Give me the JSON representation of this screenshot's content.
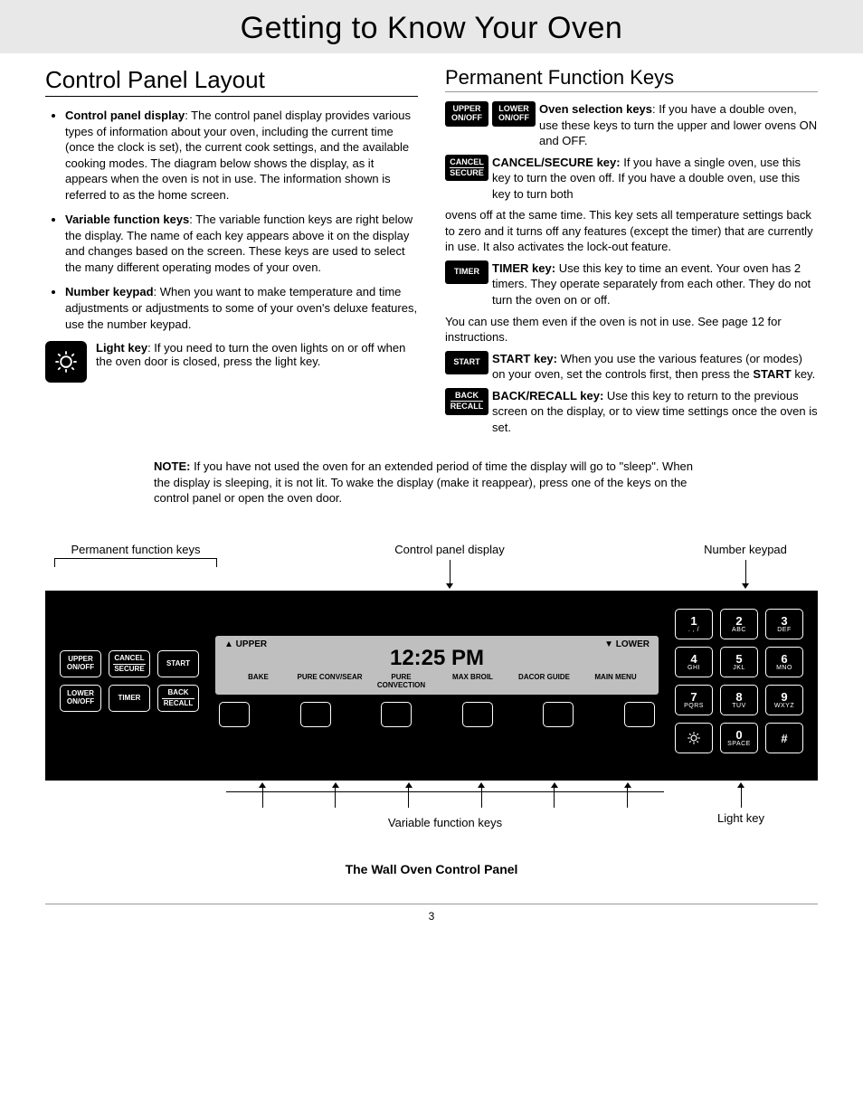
{
  "title": "Getting to Know Your Oven",
  "left": {
    "heading": "Control Panel Layout",
    "items": [
      {
        "lead": "Control panel display",
        "body": ": The control panel display provides various types of information about your oven, including the current time (once the clock is set), the current cook settings, and the available cooking modes. The diagram below shows the display, as it appears when the oven is not in use. The information shown is referred to as the home screen."
      },
      {
        "lead": "Variable function keys",
        "body": ": The variable function keys are right below the display. The name of each key appears above it on the display and changes based on the screen. These keys are used to select the many different operating modes of your oven."
      },
      {
        "lead": "Number keypad",
        "body": ": When you want to make temperature and time adjustments or adjustments to some of your oven's deluxe features, use the number keypad."
      }
    ],
    "light": {
      "lead": "Light key",
      "body": ": If you need to turn the oven lights on or off when the oven door is closed, press the light key."
    }
  },
  "right": {
    "heading": "Permanent Function Keys",
    "oven_sel": {
      "k1": {
        "l1": "UPPER",
        "l2": "ON/OFF"
      },
      "k2": {
        "l1": "LOWER",
        "l2": "ON/OFF"
      },
      "lead": "Oven selection keys",
      "body": ": If you have a double oven, use these keys to turn the upper and lower ovens ON and OFF."
    },
    "cancel": {
      "k": {
        "l1": "CANCEL",
        "l2": "SECURE"
      },
      "lead": "CANCEL/SECURE key:",
      "body": " If you have a single oven, use this key to turn the oven off. If you have a double oven, use this key to turn both",
      "cont": "ovens off at the same time. This key sets all temperature settings back to zero and it turns off any features (except the timer) that are currently in use. It also activates the lock-out feature."
    },
    "timer": {
      "k": {
        "l1": "TIMER"
      },
      "lead": "TIMER key:",
      "body": " Use this key to time an event. Your oven has 2 timers. They operate separately from each other. They do not turn the oven on or off.",
      "cont": "You can use them even if the oven is not in use. See page 12 for instructions."
    },
    "start": {
      "k": {
        "l1": "START"
      },
      "lead": "START key:",
      "body": " When you use the various features (or modes) on your oven, set the controls first, then press the ",
      "body2": "START",
      "body3": " key."
    },
    "back": {
      "k": {
        "l1": "BACK",
        "l2": "RECALL"
      },
      "lead": "BACK/RECALL key:",
      "body": " Use this key to return to the previous screen on the display, or to view time settings once the oven is set."
    }
  },
  "note": {
    "lead": "NOTE:",
    "body": " If you have not used the oven for an extended period of time the display will go to \"sleep\". When the display is sleeping, it is not lit. To wake the display (make it reappear), press one of the keys on the control panel or open the oven door."
  },
  "callout": {
    "perm": "Permanent function keys",
    "disp": "Control panel display",
    "kpad": "Number keypad",
    "var": "Variable function keys",
    "light": "Light key"
  },
  "panel": {
    "perm": [
      {
        "l1": "UPPER",
        "l2": "ON/OFF"
      },
      {
        "l1": "CANCEL",
        "l2": "SECURE",
        "u": true
      },
      {
        "l1": "START",
        "l2": ""
      },
      {
        "l1": "LOWER",
        "l2": "ON/OFF"
      },
      {
        "l1": "TIMER",
        "l2": ""
      },
      {
        "l1": "BACK",
        "l2": "RECALL",
        "u": true
      }
    ],
    "lcd": {
      "upper": "▲ UPPER",
      "lower": "▼ LOWER",
      "clock": "12:25 PM",
      "modes": [
        "BAKE",
        "PURE CONV/SEAR",
        "PURE CONVECTION",
        "MAX BROIL",
        "DACOR GUIDE",
        "MAIN MENU"
      ]
    },
    "keypad": [
      {
        "n": "1",
        "s": ". , /"
      },
      {
        "n": "2",
        "s": "ABC"
      },
      {
        "n": "3",
        "s": "DEF"
      },
      {
        "n": "4",
        "s": "GHI"
      },
      {
        "n": "5",
        "s": "JKL"
      },
      {
        "n": "6",
        "s": "MNO"
      },
      {
        "n": "7",
        "s": "PQRS"
      },
      {
        "n": "8",
        "s": "TUV"
      },
      {
        "n": "9",
        "s": "WXYZ"
      },
      {
        "n": "light",
        "s": ""
      },
      {
        "n": "0",
        "s": "SPACE"
      },
      {
        "n": "#",
        "s": ""
      }
    ]
  },
  "caption": "The Wall Oven Control Panel",
  "pagenum": "3"
}
